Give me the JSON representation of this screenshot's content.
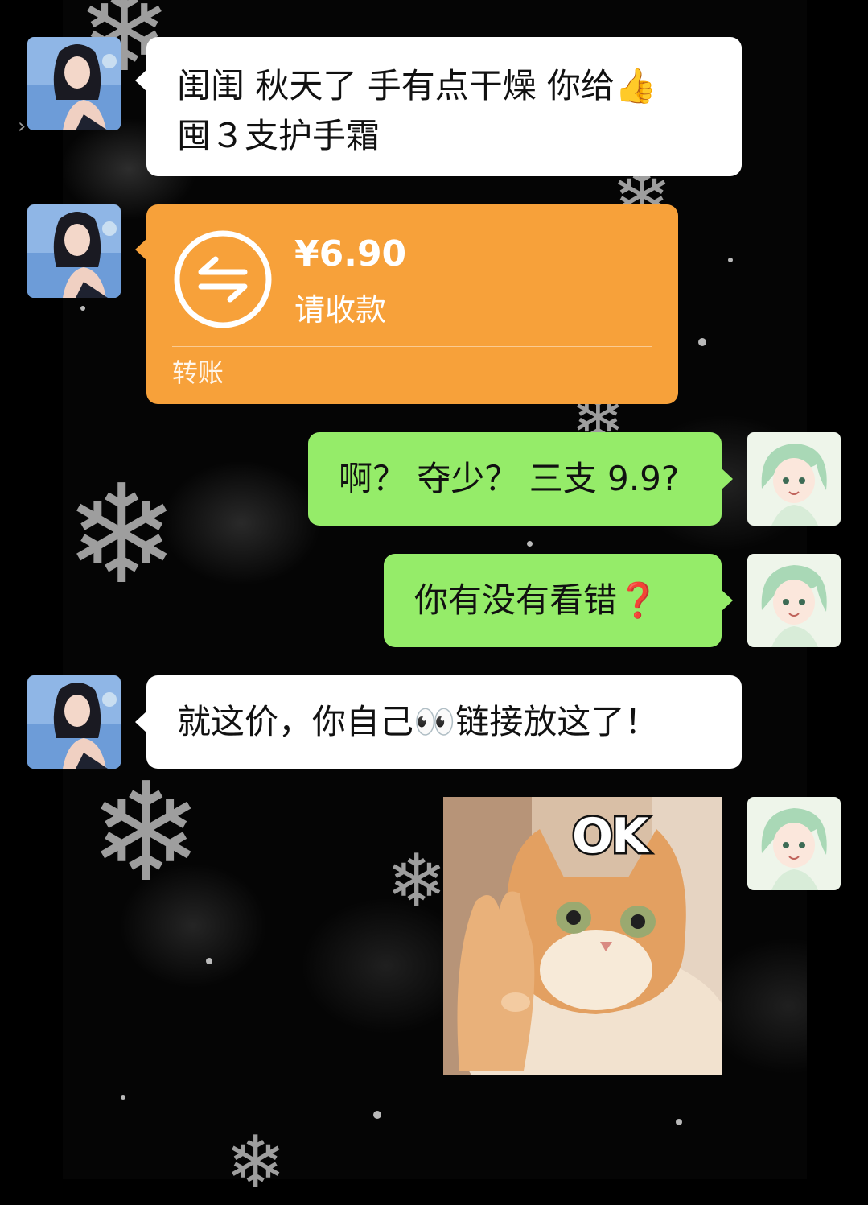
{
  "side": {
    "arrow_glyph": "›"
  },
  "messages": [
    {
      "from": "other",
      "type": "text",
      "lines": [
        "闺闺 秋天了 手有点干燥 你给",
        "囤３支护手霜"
      ],
      "emoji": "👍"
    },
    {
      "from": "other",
      "type": "transfer",
      "amount": "¥6.90",
      "status": "请收款",
      "label": "转账",
      "icon": "transfer-arrows-icon",
      "color": "#f7a13a"
    },
    {
      "from": "me",
      "type": "text",
      "text": "啊？ 夺少？ 三支 9.9?"
    },
    {
      "from": "me",
      "type": "text",
      "text": "你有没有看错",
      "emoji": "❓"
    },
    {
      "from": "other",
      "type": "text",
      "text_before": "就这价，你自己",
      "emoji": "👀",
      "text_after": "链接放这了！"
    },
    {
      "from": "me",
      "type": "sticker",
      "caption": "OK",
      "subject": "orange cat making OK hand gesture"
    }
  ],
  "colors": {
    "green_bubble": "#95ec69",
    "white_bubble": "#ffffff",
    "transfer_orange": "#f7a13a",
    "background": "#050505"
  }
}
